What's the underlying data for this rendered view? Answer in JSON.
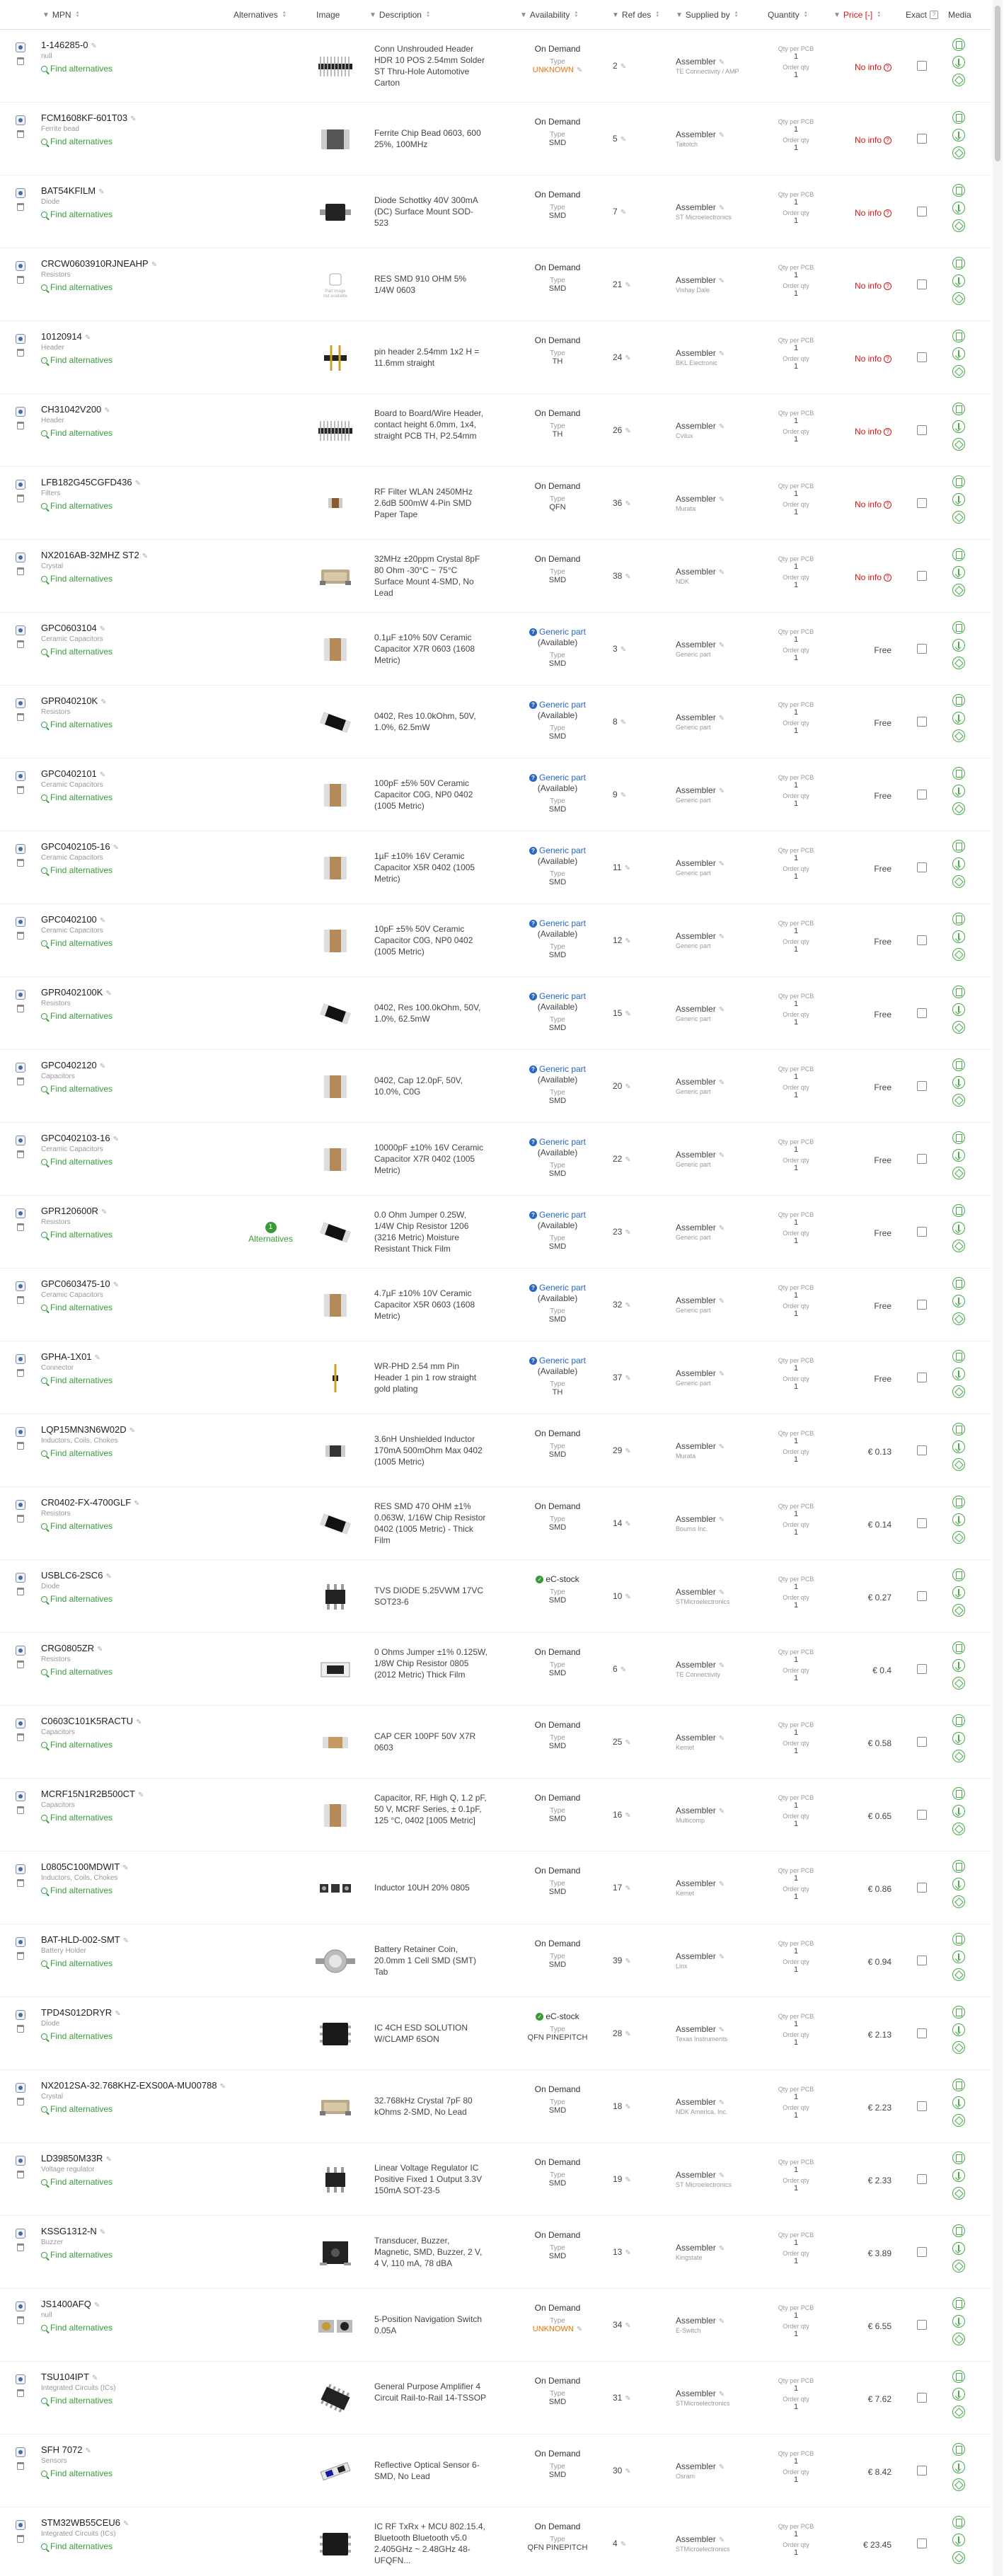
{
  "columns": {
    "mpn": "MPN",
    "alternatives": "Alternatives",
    "image": "Image",
    "description": "Description",
    "availability": "Availability",
    "refdes": "Ref des",
    "supplied_by": "Supplied by",
    "quantity": "Quantity",
    "price": "Price [-]",
    "exact": "Exact",
    "media": "Media"
  },
  "labels": {
    "find_alternatives": "Find alternatives",
    "type": "Type",
    "qty_per_pcb": "Qty per PCB",
    "order_qty": "Order qty",
    "alternatives": "Alternatives",
    "no_image": "Part image not available"
  },
  "rows": [
    {
      "mpn": "1-146285-0",
      "cat": "null",
      "desc": "Conn Unshrouded Header HDR 10 POS 2.54mm Solder ST Thru-Hole Automotive Carton",
      "avail": "On Demand",
      "type": "UNKNOWN",
      "type_unknown": true,
      "refdes": "2",
      "supplier": "Assembler",
      "sup_sub": "TE Connectivity / AMP",
      "qpp": "1",
      "oq": "1",
      "price": "No info",
      "noinfo": true,
      "img": "header"
    },
    {
      "mpn": "FCM1608KF-601T03",
      "cat": "Ferrite bead",
      "desc": "Ferrite Chip Bead 0603, 600 25%, 100MHz",
      "avail": "On Demand",
      "type": "SMD",
      "refdes": "5",
      "supplier": "Assembler",
      "sup_sub": "Taitotch",
      "qpp": "1",
      "oq": "1",
      "price": "No info",
      "noinfo": true,
      "img": "ferrite"
    },
    {
      "mpn": "BAT54KFILM",
      "cat": "Diode",
      "desc": "Diode Schottky 40V 300mA (DC) Surface Mount SOD-523",
      "avail": "On Demand",
      "type": "SMD",
      "refdes": "7",
      "supplier": "Assembler",
      "sup_sub": "ST Microelectronics",
      "qpp": "1",
      "oq": "1",
      "price": "No info",
      "noinfo": true,
      "img": "diode"
    },
    {
      "mpn": "CRCW0603910RJNEAHP",
      "cat": "Resistors",
      "desc": "RES SMD 910 OHM 5% 1/4W 0603",
      "avail": "On Demand",
      "type": "SMD",
      "refdes": "21",
      "supplier": "Assembler",
      "sup_sub": "Vishay Dale",
      "qpp": "1",
      "oq": "1",
      "price": "No info",
      "noinfo": true,
      "img": "none"
    },
    {
      "mpn": "10120914",
      "cat": "Header",
      "desc": "pin header 2.54mm 1x2 H = 11.6mm straight",
      "avail": "On Demand",
      "type": "TH",
      "refdes": "24",
      "supplier": "Assembler",
      "sup_sub": "BKL Electronic",
      "qpp": "1",
      "oq": "1",
      "price": "No info",
      "noinfo": true,
      "img": "pin2"
    },
    {
      "mpn": "CH31042V200",
      "cat": "Header",
      "desc": "Board to Board/Wire Header, contact height 6.0mm, 1x4, straight PCB TH, P2.54mm",
      "avail": "On Demand",
      "type": "TH",
      "refdes": "26",
      "supplier": "Assembler",
      "sup_sub": "Cvilux",
      "qpp": "1",
      "oq": "1",
      "price": "No info",
      "noinfo": true,
      "img": "header"
    },
    {
      "mpn": "LFB182G45CGFD436",
      "cat": "Filters",
      "desc": "RF Filter WLAN 2450MHz 2.6dB 500mW 4-Pin SMD Paper Tape",
      "avail": "On Demand",
      "type": "QFN",
      "refdes": "36",
      "supplier": "Assembler",
      "sup_sub": "Murata",
      "qpp": "1",
      "oq": "1",
      "price": "No info",
      "noinfo": true,
      "img": "filter"
    },
    {
      "mpn": "NX2016AB-32MHZ ST2",
      "cat": "Crystal",
      "desc": "32MHz ±20ppm Crystal 8pF 80 Ohm -30°C ~ 75°C Surface Mount 4-SMD, No Lead",
      "avail": "On Demand",
      "type": "SMD",
      "refdes": "38",
      "supplier": "Assembler",
      "sup_sub": "NDK",
      "qpp": "1",
      "oq": "1",
      "price": "No info",
      "noinfo": true,
      "img": "crystal"
    },
    {
      "mpn": "GPC0603104",
      "cat": "Ceramic Capacitors",
      "desc": "0.1µF ±10% 50V Ceramic Capacitor X7R 0603 (1608 Metric)",
      "avail": "Generic part",
      "avail_sub": "(Available)",
      "generic": true,
      "type": "SMD",
      "refdes": "3",
      "supplier": "Assembler",
      "sup_sub": "Generic part",
      "qpp": "1",
      "oq": "1",
      "price": "Free",
      "img": "cap"
    },
    {
      "mpn": "GPR040210K",
      "cat": "Resistors",
      "desc": "0402, Res 10.0kOhm, 50V, 1.0%, 62.5mW",
      "avail": "Generic part",
      "avail_sub": "(Available)",
      "generic": true,
      "type": "SMD",
      "refdes": "8",
      "supplier": "Assembler",
      "sup_sub": "Generic part",
      "qpp": "1",
      "oq": "1",
      "price": "Free",
      "img": "res"
    },
    {
      "mpn": "GPC0402101",
      "cat": "Ceramic Capacitors",
      "desc": "100pF ±5% 50V Ceramic Capacitor C0G, NP0 0402 (1005 Metric)",
      "avail": "Generic part",
      "avail_sub": "(Available)",
      "generic": true,
      "type": "SMD",
      "refdes": "9",
      "supplier": "Assembler",
      "sup_sub": "Generic part",
      "qpp": "1",
      "oq": "1",
      "price": "Free",
      "img": "cap"
    },
    {
      "mpn": "GPC0402105-16",
      "cat": "Ceramic Capacitors",
      "desc": "1µF ±10% 16V Ceramic Capacitor X5R 0402 (1005 Metric)",
      "avail": "Generic part",
      "avail_sub": "(Available)",
      "generic": true,
      "type": "SMD",
      "refdes": "11",
      "supplier": "Assembler",
      "sup_sub": "Generic part",
      "qpp": "1",
      "oq": "1",
      "price": "Free",
      "img": "cap"
    },
    {
      "mpn": "GPC0402100",
      "cat": "Ceramic Capacitors",
      "desc": "10pF ±5% 50V Ceramic Capacitor C0G, NP0 0402 (1005 Metric)",
      "avail": "Generic part",
      "avail_sub": "(Available)",
      "generic": true,
      "type": "SMD",
      "refdes": "12",
      "supplier": "Assembler",
      "sup_sub": "Generic part",
      "qpp": "1",
      "oq": "1",
      "price": "Free",
      "img": "cap"
    },
    {
      "mpn": "GPR0402100K",
      "cat": "Resistors",
      "desc": "0402, Res 100.0kOhm, 50V, 1.0%, 62.5mW",
      "avail": "Generic part",
      "avail_sub": "(Available)",
      "generic": true,
      "type": "SMD",
      "refdes": "15",
      "supplier": "Assembler",
      "sup_sub": "Generic part",
      "qpp": "1",
      "oq": "1",
      "price": "Free",
      "img": "res"
    },
    {
      "mpn": "GPC0402120",
      "cat": "Capacitors",
      "desc": "0402, Cap 12.0pF, 50V, 10.0%, C0G",
      "avail": "Generic part",
      "avail_sub": "(Available)",
      "generic": true,
      "type": "SMD",
      "refdes": "20",
      "supplier": "Assembler",
      "sup_sub": "Generic part",
      "qpp": "1",
      "oq": "1",
      "price": "Free",
      "img": "cap"
    },
    {
      "mpn": "GPC0402103-16",
      "cat": "Ceramic Capacitors",
      "desc": "10000pF ±10% 16V Ceramic Capacitor X7R 0402 (1005 Metric)",
      "avail": "Generic part",
      "avail_sub": "(Available)",
      "generic": true,
      "type": "SMD",
      "refdes": "22",
      "supplier": "Assembler",
      "sup_sub": "Generic part",
      "qpp": "1",
      "oq": "1",
      "price": "Free",
      "img": "cap"
    },
    {
      "mpn": "GPR120600R",
      "cat": "Resistors",
      "desc": "0.0 Ohm Jumper 0.25W, 1/4W Chip Resistor 1206 (3216 Metric) Moisture Resistant Thick Film",
      "avail": "Generic part",
      "avail_sub": "(Available)",
      "generic": true,
      "type": "SMD",
      "refdes": "23",
      "supplier": "Assembler",
      "sup_sub": "Generic part",
      "qpp": "1",
      "oq": "1",
      "price": "Free",
      "img": "res",
      "alternatives": "1"
    },
    {
      "mpn": "GPC0603475-10",
      "cat": "Ceramic Capacitors",
      "desc": "4.7µF ±10% 10V Ceramic Capacitor X5R 0603 (1608 Metric)",
      "avail": "Generic part",
      "avail_sub": "(Available)",
      "generic": true,
      "type": "SMD",
      "refdes": "32",
      "supplier": "Assembler",
      "sup_sub": "Generic part",
      "qpp": "1",
      "oq": "1",
      "price": "Free",
      "img": "cap"
    },
    {
      "mpn": "GPHA-1X01",
      "cat": "Connector",
      "desc": "WR-PHD 2.54 mm Pin Header 1 pin 1 row straight gold plating",
      "avail": "Generic part",
      "avail_sub": "(Available)",
      "generic": true,
      "type": "TH",
      "refdes": "37",
      "supplier": "Assembler",
      "sup_sub": "Generic part",
      "qpp": "1",
      "oq": "1",
      "price": "Free",
      "img": "pin1"
    },
    {
      "mpn": "LQP15MN3N6W02D",
      "cat": "Inductors, Coils, Chokes",
      "desc": "3.6nH Unshielded Inductor 170mA 500mOhm Max 0402 (1005 Metric)",
      "avail": "On Demand",
      "type": "SMD",
      "refdes": "29",
      "supplier": "Assembler",
      "sup_sub": "Murata",
      "qpp": "1",
      "oq": "1",
      "price": "€ 0.13",
      "img": "ind_small"
    },
    {
      "mpn": "CR0402-FX-4700GLF",
      "cat": "Resistors",
      "desc": "RES SMD 470 OHM ±1% 0.063W, 1/16W Chip Resistor 0402 (1005 Metric) - Thick Film",
      "avail": "On Demand",
      "type": "SMD",
      "refdes": "14",
      "supplier": "Assembler",
      "sup_sub": "Bourns Inc.",
      "qpp": "1",
      "oq": "1",
      "price": "€ 0.14",
      "img": "res"
    },
    {
      "mpn": "USBLC6-2SC6",
      "cat": "Diode",
      "desc": "TVS DIODE 5.25VWM 17VC SOT23-6",
      "avail": "eC-stock",
      "ecstock": true,
      "type": "SMD",
      "refdes": "10",
      "supplier": "Assembler",
      "sup_sub": "STMicroelectronics",
      "qpp": "1",
      "oq": "1",
      "price": "€ 0.27",
      "img": "sot"
    },
    {
      "mpn": "CRG0805ZR",
      "cat": "Resistors",
      "desc": "0 Ohms Jumper ±1% 0.125W, 1/8W Chip Resistor 0805 (2012 Metric) Thick Film",
      "avail": "On Demand",
      "type": "SMD",
      "refdes": "6",
      "supplier": "Assembler",
      "sup_sub": "TE Connectivity",
      "qpp": "1",
      "oq": "1",
      "price": "€ 0.4",
      "img": "res_white"
    },
    {
      "mpn": "C0603C101K5RACTU",
      "cat": "Capacitors",
      "desc": "CAP CER 100PF 50V X7R 0603",
      "avail": "On Demand",
      "type": "SMD",
      "refdes": "25",
      "supplier": "Assembler",
      "sup_sub": "Kemet",
      "qpp": "1",
      "oq": "1",
      "price": "€ 0.58",
      "img": "cap_flat"
    },
    {
      "mpn": "MCRF15N1R2B500CT",
      "cat": "Capacitors",
      "desc": "Capacitor, RF, High Q, 1.2 pF, 50 V, MCRF Series, ± 0.1pF, 125 °C, 0402 [1005 Metric]",
      "avail": "On Demand",
      "type": "SMD",
      "refdes": "16",
      "supplier": "Assembler",
      "sup_sub": "Multicomp",
      "qpp": "1",
      "oq": "1",
      "price": "€ 0.65",
      "img": "cap"
    },
    {
      "mpn": "L0805C100MDWIT",
      "cat": "Inductors, Coils, Chokes",
      "desc": "Inductor 10UH 20% 0805",
      "avail": "On Demand",
      "type": "SMD",
      "refdes": "17",
      "supplier": "Assembler",
      "sup_sub": "Kemet",
      "qpp": "1",
      "oq": "1",
      "price": "€ 0.86",
      "img": "ind"
    },
    {
      "mpn": "BAT-HLD-002-SMT",
      "cat": "Battery Holder",
      "desc": "Battery Retainer Coin, 20.0mm 1 Cell SMD (SMT) Tab",
      "avail": "On Demand",
      "type": "SMD",
      "refdes": "39",
      "supplier": "Assembler",
      "sup_sub": "Linx",
      "qpp": "1",
      "oq": "1",
      "price": "€ 0.94",
      "img": "battery"
    },
    {
      "mpn": "TPD4S012DRYR",
      "cat": "Diode",
      "desc": "IC 4CH ESD SOLUTION W/CLAMP 6SON",
      "avail": "eC-stock",
      "ecstock": true,
      "type": "QFN PINEPITCH",
      "refdes": "28",
      "supplier": "Assembler",
      "sup_sub": "Texas Instruments",
      "qpp": "1",
      "oq": "1",
      "price": "€ 2.13",
      "img": "qfn"
    },
    {
      "mpn": "NX2012SA-32.768KHZ-EXS00A-MU00788",
      "cat": "Crystal",
      "desc": "32.768kHz Crystal 7pF 80 kOhms 2-SMD, No Lead",
      "avail": "On Demand",
      "type": "SMD",
      "refdes": "18",
      "supplier": "Assembler",
      "sup_sub": "NDK America, Inc.",
      "qpp": "1",
      "oq": "1",
      "price": "€ 2.23",
      "img": "crystal"
    },
    {
      "mpn": "LD39850M33R",
      "cat": "Voltage regulator",
      "desc": "Linear Voltage Regulator IC Positive Fixed 1 Output 3.3V 150mA SOT-23-5",
      "avail": "On Demand",
      "type": "SMD",
      "refdes": "19",
      "supplier": "Assembler",
      "sup_sub": "ST Microelectronics",
      "qpp": "1",
      "oq": "1",
      "price": "€ 2.33",
      "img": "sot"
    },
    {
      "mpn": "KSSG1312-N",
      "cat": "Buzzer",
      "desc": "Transducer, Buzzer, Magnetic, SMD, Buzzer, 2 V, 4 V, 110 mA, 78 dBA",
      "avail": "On Demand",
      "type": "SMD",
      "refdes": "13",
      "supplier": "Assembler",
      "sup_sub": "Kingstate",
      "qpp": "1",
      "oq": "1",
      "price": "€ 3.89",
      "img": "buzzer"
    },
    {
      "mpn": "JS1400AFQ",
      "cat": "null",
      "desc": "5-Position Navigation Switch 0.05A",
      "avail": "On Demand",
      "type": "UNKNOWN",
      "type_unknown": true,
      "refdes": "34",
      "supplier": "Assembler",
      "sup_sub": "E-Switch",
      "qpp": "1",
      "oq": "1",
      "price": "€ 6.55",
      "img": "switch"
    },
    {
      "mpn": "TSU104IPT",
      "cat": "Integrated Circuits (ICs)",
      "desc": "General Purpose Amplifier 4 Circuit Rail-to-Rail 14-TSSOP",
      "avail": "On Demand",
      "type": "SMD",
      "refdes": "31",
      "supplier": "Assembler",
      "sup_sub": "STMicroelectronics",
      "qpp": "1",
      "oq": "1",
      "price": "€ 7.62",
      "img": "tssop"
    },
    {
      "mpn": "SFH 7072",
      "cat": "Sensors",
      "desc": "Reflective Optical Sensor 6-SMD, No Lead",
      "avail": "On Demand",
      "type": "SMD",
      "refdes": "30",
      "supplier": "Assembler",
      "sup_sub": "Osram",
      "qpp": "1",
      "oq": "1",
      "price": "€ 8.42",
      "img": "sensor"
    },
    {
      "mpn": "STM32WB55CEU6",
      "cat": "Integrated Circuits (ICs)",
      "desc": "IC RF TxRx + MCU 802.15.4, Bluetooth Bluetooth v5.0 2.405GHz ~ 2.48GHz 48-UFQFN...",
      "avail": "On Demand",
      "type": "QFN PINEPITCH",
      "refdes": "4",
      "supplier": "Assembler",
      "sup_sub": "STMicroelectronics",
      "qpp": "1",
      "oq": "1",
      "price": "€ 23.45",
      "img": "qfn"
    }
  ]
}
